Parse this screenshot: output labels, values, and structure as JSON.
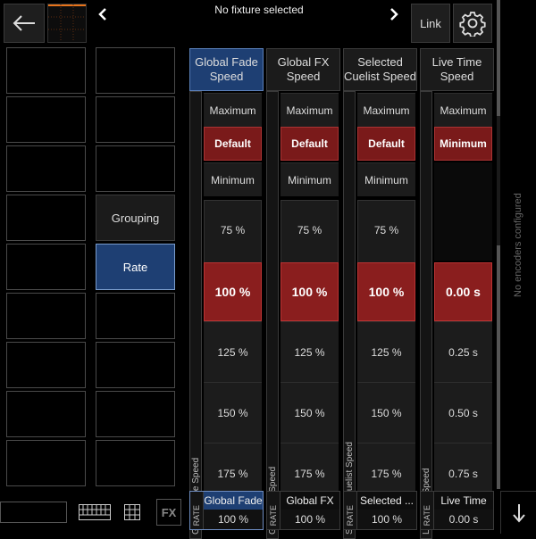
{
  "header": {
    "title": "No fixture selected",
    "link_label": "Link"
  },
  "side_buttons": {
    "grouping": "Grouping",
    "rate": "Rate"
  },
  "columns": [
    {
      "header": "Global Fade Speed",
      "strip_label": "Global Fade Speed",
      "top_options": [
        "Maximum",
        "Default",
        "Minimum"
      ],
      "scale": [
        "75 %",
        "100 %",
        "125 %",
        "150 %",
        "175 %"
      ],
      "footer_tag": "RATE",
      "footer_name": "Global Fade",
      "footer_value": "100 %"
    },
    {
      "header": "Global FX Speed",
      "strip_label": "Global FX Speed",
      "top_options": [
        "Maximum",
        "Default",
        "Minimum"
      ],
      "scale": [
        "75 %",
        "100 %",
        "125 %",
        "150 %",
        "175 %"
      ],
      "footer_tag": "RATE",
      "footer_name": "Global FX",
      "footer_value": "100 %"
    },
    {
      "header": "Selected Cuelist Speed",
      "strip_label": "Selected Cuelist Speed",
      "top_options": [
        "Maximum",
        "Default",
        "Minimum"
      ],
      "scale": [
        "75 %",
        "100 %",
        "125 %",
        "150 %",
        "175 %"
      ],
      "footer_tag": "RATE",
      "footer_name": "Selected ...",
      "footer_value": "100 %"
    },
    {
      "header": "Live Time Speed",
      "strip_label": "Live Time Speed",
      "top_options": [
        "Maximum",
        "Minimum"
      ],
      "scale": [
        "0.00 s",
        "0.25 s",
        "0.50 s",
        "0.75 s"
      ],
      "footer_tag": "RATE",
      "footer_name": "Live Time",
      "footer_value": "0.00 s"
    }
  ],
  "right_panel": {
    "message": "No encoders configured"
  },
  "bottom_bar": {
    "fx_label": "FX"
  },
  "colors": {
    "selected_blue": "#1e3f73",
    "default_red": "#7a1a1a",
    "accent_orange": "#e8731a"
  }
}
